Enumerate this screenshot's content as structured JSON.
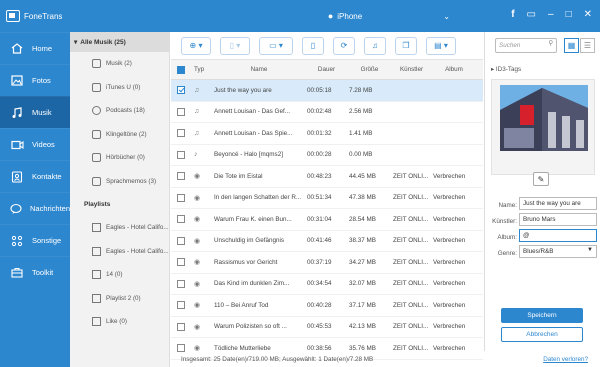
{
  "app": {
    "name": "FoneTrans",
    "device": "iPhone"
  },
  "colors": {
    "brand": "#2d87cf",
    "active_nav": "#1c66a6"
  },
  "window_controls": [
    "f",
    "message-icon",
    "–",
    "□",
    "✕"
  ],
  "nav": [
    {
      "label": "Home",
      "icon": "home-icon"
    },
    {
      "label": "Fotos",
      "icon": "photos-icon"
    },
    {
      "label": "Musik",
      "icon": "music-icon"
    },
    {
      "label": "Videos",
      "icon": "video-icon"
    },
    {
      "label": "Kontakte",
      "icon": "contacts-icon"
    },
    {
      "label": "Nachrichten",
      "icon": "messages-icon"
    },
    {
      "label": "Sonstige",
      "icon": "other-icon"
    },
    {
      "label": "Toolkit",
      "icon": "toolkit-icon"
    }
  ],
  "categories": {
    "header": "Alle Musik (25)",
    "items": [
      "Musik (2)",
      "iTunes U (0)",
      "Podcasts (18)",
      "Klingeltöne (2)",
      "Hörbücher (0)",
      "Sprachmemos (3)"
    ],
    "playlists_title": "Playlists",
    "playlists": [
      "Eagles - Hotel Califo...",
      "Eagles - Hotel Califo...",
      "14 (0)",
      "Playlist 2 (0)",
      "Like (0)"
    ]
  },
  "search": {
    "placeholder": "Suchen"
  },
  "table": {
    "headers": {
      "type": "Typ",
      "name": "Name",
      "duration": "Dauer",
      "size": "Größe",
      "artist": "Künstler",
      "album": "Album"
    },
    "rows": [
      {
        "name": "Just the way you are",
        "duration": "00:05:18",
        "size": "7.28 MB",
        "artist": "",
        "album": "",
        "icon": "♫"
      },
      {
        "name": "Annett Louisan - Das Gef...",
        "duration": "00:02:48",
        "size": "2.56 MB",
        "artist": "",
        "album": "",
        "icon": "♫"
      },
      {
        "name": "Annett Louisan - Das Spie...",
        "duration": "00:01:32",
        "size": "1.41 MB",
        "artist": "",
        "album": "",
        "icon": "♫"
      },
      {
        "name": "Beyoncé - Halo [mqms2]",
        "duration": "00:00:28",
        "size": "0.00 MB",
        "artist": "",
        "album": "",
        "icon": "♪"
      },
      {
        "name": "Die Tote im Eistal",
        "duration": "00:48:23",
        "size": "44.45 MB",
        "artist": "ZEIT ONLI...",
        "album": "Verbrechen",
        "icon": "◉"
      },
      {
        "name": "In den langen Schatten der R...",
        "duration": "00:51:34",
        "size": "47.38 MB",
        "artist": "ZEIT ONLI...",
        "album": "Verbrechen",
        "icon": "◉"
      },
      {
        "name": "Warum Frau K. einen Bun...",
        "duration": "00:31:04",
        "size": "28.54 MB",
        "artist": "ZEIT ONLI...",
        "album": "Verbrechen",
        "icon": "◉"
      },
      {
        "name": "Unschuldig im Gefängnis",
        "duration": "00:41:46",
        "size": "38.37 MB",
        "artist": "ZEIT ONLI...",
        "album": "Verbrechen",
        "icon": "◉"
      },
      {
        "name": "Rassismus vor Gericht",
        "duration": "00:37:19",
        "size": "34.27 MB",
        "artist": "ZEIT ONLI...",
        "album": "Verbrechen",
        "icon": "◉"
      },
      {
        "name": "Das Kind im dunklen Zim...",
        "duration": "00:34:54",
        "size": "32.07 MB",
        "artist": "ZEIT ONLI...",
        "album": "Verbrechen",
        "icon": "◉"
      },
      {
        "name": "110 – Bei Anruf Tod",
        "duration": "00:40:28",
        "size": "37.17 MB",
        "artist": "ZEIT ONLI...",
        "album": "Verbrechen",
        "icon": "◉"
      },
      {
        "name": "Warum Polizisten so oft ...",
        "duration": "00:45:53",
        "size": "42.13 MB",
        "artist": "ZEIT ONLI...",
        "album": "Verbrechen",
        "icon": "◉"
      },
      {
        "name": "Tödliche Mutterliebe",
        "duration": "00:38:56",
        "size": "35.76 MB",
        "artist": "ZEIT ONLI...",
        "album": "Verbrechen",
        "icon": "◉"
      }
    ]
  },
  "status": {
    "summary": "Insgesamt: 25 Date(en)/719.00 MB; Ausgewählt: 1 Date(en)/7.28 MB",
    "link": "Daten verloren?"
  },
  "id3": {
    "title": "ID3-Tags",
    "name_label": "Name:",
    "name_value": "Just the way you are",
    "artist_label": "Künstler:",
    "artist_value": "Bruno Mars",
    "album_label": "Album:",
    "album_value": "@",
    "genre_label": "Genre:",
    "genre_value": "Blues/R&B",
    "save": "Speichern",
    "cancel": "Abbrechen"
  }
}
